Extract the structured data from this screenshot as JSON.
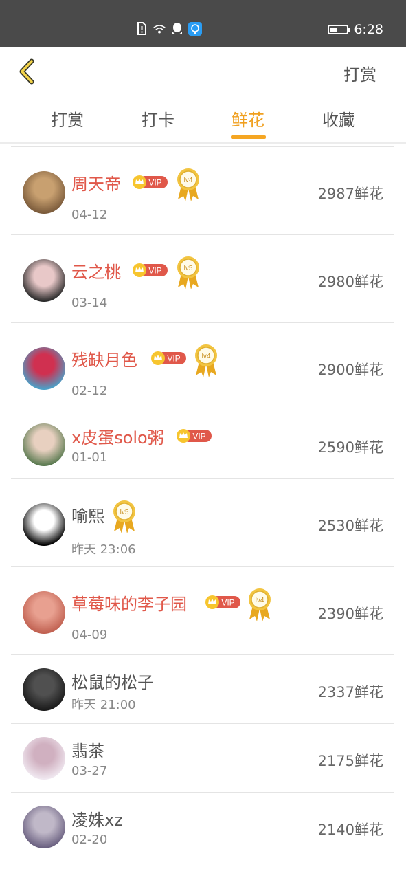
{
  "status_bar": {
    "time": "6:28",
    "battery_level": 0.4
  },
  "nav": {
    "right_label": "打赏"
  },
  "tabs": [
    {
      "label": "打赏",
      "active": false
    },
    {
      "label": "打卡",
      "active": false
    },
    {
      "label": "鲜花",
      "active": true
    },
    {
      "label": "收藏",
      "active": false
    }
  ],
  "colors": {
    "accent": "#f5a623",
    "vip_name": "#e0584a",
    "vip_badge": "#e0584a"
  },
  "badges": {
    "vip_text": "VIP"
  },
  "rows": [
    {
      "name": "周天帝",
      "date": "04-12",
      "amount": "2987鲜花",
      "vip": true,
      "level": "lv4"
    },
    {
      "name": "云之桃",
      "date": "03-14",
      "amount": "2980鲜花",
      "vip": true,
      "level": "lv5"
    },
    {
      "name": "残缺月色",
      "date": "02-12",
      "amount": "2900鲜花",
      "vip": true,
      "level": "lv4"
    },
    {
      "name": "x皮蛋solo粥",
      "date": "01-01",
      "amount": "2590鲜花",
      "vip": true,
      "level": ""
    },
    {
      "name": "喻熙",
      "date": "昨天 23:06",
      "amount": "2530鲜花",
      "vip": false,
      "level": "lv5"
    },
    {
      "name": "草莓味的李子园",
      "date": "04-09",
      "amount": "2390鲜花",
      "vip": true,
      "level": "lv4"
    },
    {
      "name": "松鼠的松子",
      "date": "昨天 21:00",
      "amount": "2337鲜花",
      "vip": false,
      "level": ""
    },
    {
      "name": "翡茶",
      "date": "03-27",
      "amount": "2175鲜花",
      "vip": false,
      "level": ""
    },
    {
      "name": "凌姝xz",
      "date": "02-20",
      "amount": "2140鲜花",
      "vip": false,
      "level": ""
    }
  ]
}
